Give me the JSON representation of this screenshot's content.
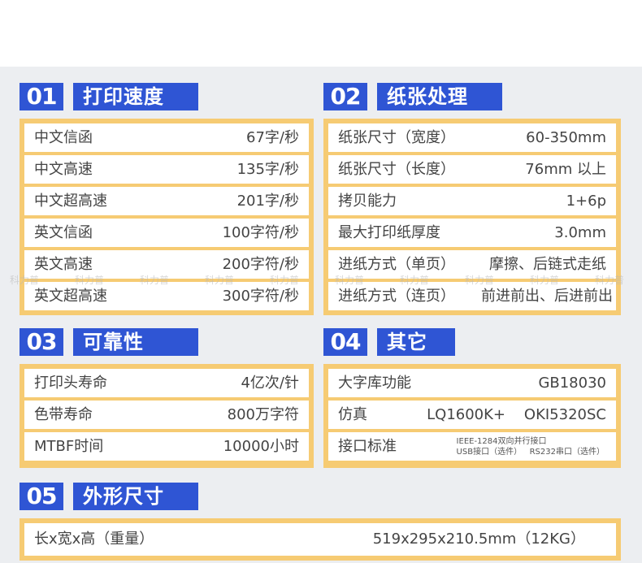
{
  "sections": [
    {
      "number": "01",
      "title": "打印速度",
      "rows": [
        {
          "label": "中文信函",
          "value": "67字/秒"
        },
        {
          "label": "中文高速",
          "value": "135字/秒"
        },
        {
          "label": "中文超高速",
          "value": "201字/秒"
        },
        {
          "label": "英文信函",
          "value": "100字符/秒"
        },
        {
          "label": "英文高速",
          "value": "200字符/秒"
        },
        {
          "label": "英文超高速",
          "value": "300字符/秒"
        }
      ]
    },
    {
      "number": "02",
      "title": "纸张处理",
      "rows": [
        {
          "label": "纸张尺寸（宽度）",
          "value": "60-350mm"
        },
        {
          "label": "纸张尺寸（长度）",
          "value": "76mm 以上"
        },
        {
          "label": "拷贝能力",
          "value": "1+6p"
        },
        {
          "label": "最大打印纸厚度",
          "value": "3.0mm"
        },
        {
          "label": "进纸方式（单页）",
          "value": "摩擦、后链式走纸"
        },
        {
          "label": "进纸方式（连页）",
          "value": "前进前出、后进前出"
        }
      ]
    },
    {
      "number": "03",
      "title": "可靠性",
      "rows": [
        {
          "label": "打印头寿命",
          "value": "4亿次/针"
        },
        {
          "label": "色带寿命",
          "value": "800万字符"
        },
        {
          "label": "MTBF时间",
          "value": "10000小时"
        }
      ]
    },
    {
      "number": "04",
      "title": "其它",
      "rows": [
        {
          "label": "大字库功能",
          "value": "GB18030"
        },
        {
          "label": "仿真",
          "value": "LQ1600K+    OKI5320SC"
        },
        {
          "label": "接口标准",
          "value_line1": "IEEE-1284双向并行接口",
          "value_line2": "USB接口（选件）   RS232串口（选件）"
        }
      ]
    },
    {
      "number": "05",
      "title": "外形尺寸",
      "rows": [
        {
          "label": "长x宽x高（重量）",
          "value": "519x295x210.5mm（12KG）"
        }
      ]
    }
  ],
  "watermark": "科力普",
  "colors": {
    "badge": "#2f55d4",
    "box": "#f6cb73",
    "panel": "#eceef1"
  }
}
